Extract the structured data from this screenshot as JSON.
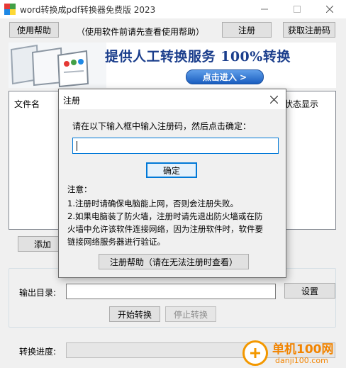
{
  "window": {
    "title": "word转换成pdf转换器免费版 2023"
  },
  "toolbar": {
    "help_label": "使用帮助",
    "hint": "（使用软件前请先查看使用帮助）",
    "register_label": "注册",
    "get_code_label": "获取注册码"
  },
  "banner": {
    "headline": "提供人工转换服务 100%转换",
    "button_label": "点击进入 >"
  },
  "filelist": {
    "columns": [
      "文件名",
      "状态显示"
    ]
  },
  "actions": {
    "add_label": "添加"
  },
  "output": {
    "dir_label": "输出目录:",
    "dir_value": "",
    "settings_label": "设置",
    "start_label": "开始转换",
    "stop_label": "停止转换"
  },
  "progress": {
    "label": "转换进度:",
    "value": 0
  },
  "dialog": {
    "title": "注册",
    "prompt": "请在以下输入框中输入注册码，然后点击确定：",
    "input_value": "",
    "ok_label": "确定",
    "note_title": "注意：",
    "notes": [
      "1.注册时请确保电脑能上网，否则会注册失败。",
      "2.如果电脑装了防火墙，注册时请先退出防火墙或在防",
      "火墙中允许该软件连接网络，因为注册软件时，软件要",
      "链接网络服务器进行验证。"
    ],
    "help_label": "注册帮助（请在无法注册时查看）"
  },
  "watermark": {
    "name": "单机100网",
    "domain": "danji100.com"
  },
  "colors": {
    "accent": "#0078d7",
    "banner_text": "#1b3e8c",
    "watermark": "#f28400"
  }
}
